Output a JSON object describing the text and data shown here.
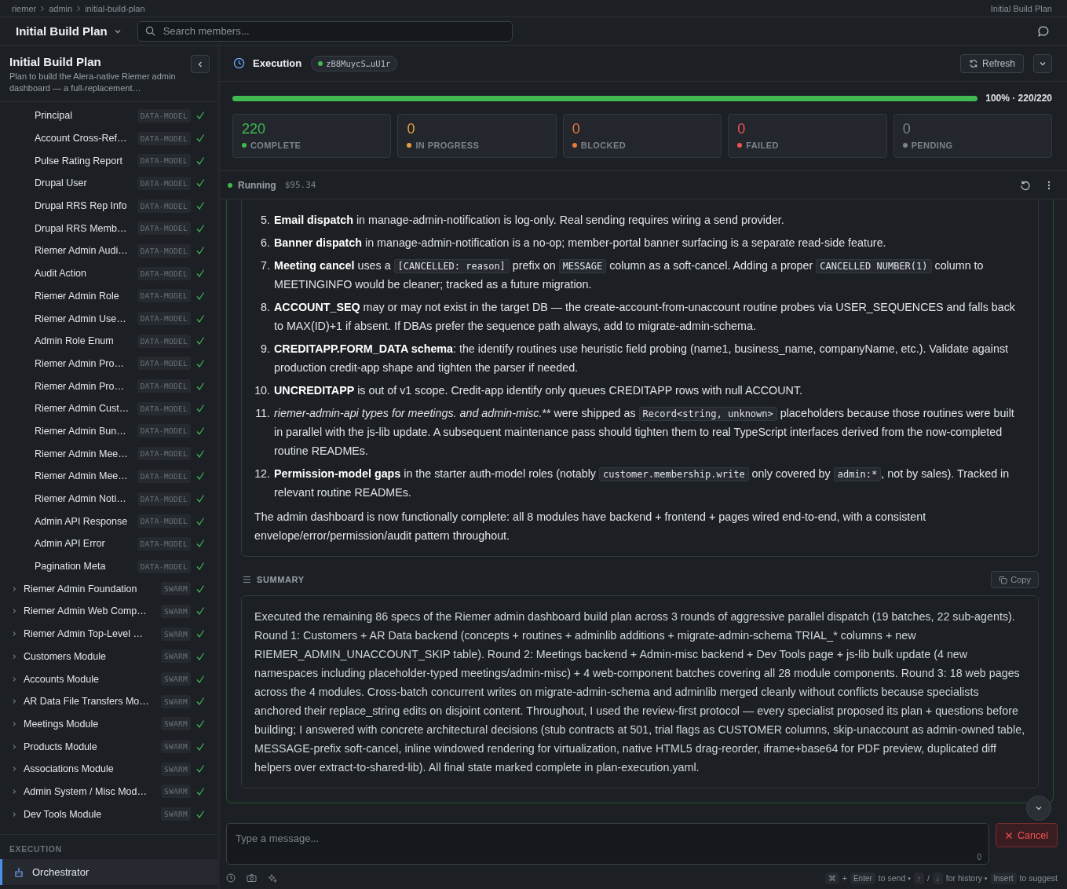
{
  "breadcrumb": {
    "items": [
      "riemer",
      "admin",
      "initial-build-plan"
    ],
    "right": "Initial Build Plan"
  },
  "header": {
    "title": "Initial Build Plan",
    "search_placeholder": "Search members..."
  },
  "sidebar": {
    "title": "Initial Build Plan",
    "description": "Plan to build the Alera-native Riemer admin dashboard — a full-replacement…",
    "items": [
      {
        "kind": "leaf",
        "label": "Principal",
        "tag": "DATA-MODEL",
        "done": true
      },
      {
        "kind": "leaf",
        "label": "Account Cross-Ref…",
        "tag": "DATA-MODEL",
        "done": true
      },
      {
        "kind": "leaf",
        "label": "Pulse Rating Report",
        "tag": "DATA-MODEL",
        "done": true
      },
      {
        "kind": "leaf",
        "label": "Drupal User",
        "tag": "DATA-MODEL",
        "done": true
      },
      {
        "kind": "leaf",
        "label": "Drupal RRS Rep Info",
        "tag": "DATA-MODEL",
        "done": true
      },
      {
        "kind": "leaf",
        "label": "Drupal RRS Memb…",
        "tag": "DATA-MODEL",
        "done": true
      },
      {
        "kind": "leaf",
        "label": "Riemer Admin Audi…",
        "tag": "DATA-MODEL",
        "done": true
      },
      {
        "kind": "leaf",
        "label": "Audit Action",
        "tag": "DATA-MODEL",
        "done": true
      },
      {
        "kind": "leaf",
        "label": "Riemer Admin Role",
        "tag": "DATA-MODEL",
        "done": true
      },
      {
        "kind": "leaf",
        "label": "Riemer Admin Use…",
        "tag": "DATA-MODEL",
        "done": true
      },
      {
        "kind": "leaf",
        "label": "Admin Role Enum",
        "tag": "DATA-MODEL",
        "done": true
      },
      {
        "kind": "leaf",
        "label": "Riemer Admin Pro…",
        "tag": "DATA-MODEL",
        "done": true
      },
      {
        "kind": "leaf",
        "label": "Riemer Admin Pro…",
        "tag": "DATA-MODEL",
        "done": true
      },
      {
        "kind": "leaf",
        "label": "Riemer Admin Cust…",
        "tag": "DATA-MODEL",
        "done": true
      },
      {
        "kind": "leaf",
        "label": "Riemer Admin Bun…",
        "tag": "DATA-MODEL",
        "done": true
      },
      {
        "kind": "leaf",
        "label": "Riemer Admin Mee…",
        "tag": "DATA-MODEL",
        "done": true
      },
      {
        "kind": "leaf",
        "label": "Riemer Admin Mee…",
        "tag": "DATA-MODEL",
        "done": true
      },
      {
        "kind": "leaf",
        "label": "Riemer Admin Noti…",
        "tag": "DATA-MODEL",
        "done": true
      },
      {
        "kind": "leaf",
        "label": "Admin API Response",
        "tag": "DATA-MODEL",
        "done": true
      },
      {
        "kind": "leaf",
        "label": "Admin API Error",
        "tag": "DATA-MODEL",
        "done": true
      },
      {
        "kind": "leaf",
        "label": "Pagination Meta",
        "tag": "DATA-MODEL",
        "done": true
      },
      {
        "kind": "group",
        "label": "Riemer Admin Foundation",
        "tag": "SWARM",
        "done": true
      },
      {
        "kind": "group",
        "label": "Riemer Admin Web Comp…",
        "tag": "SWARM",
        "done": true
      },
      {
        "kind": "group",
        "label": "Riemer Admin Top-Level …",
        "tag": "SWARM",
        "done": true
      },
      {
        "kind": "group",
        "label": "Customers Module",
        "tag": "SWARM",
        "done": true
      },
      {
        "kind": "group",
        "label": "Accounts Module",
        "tag": "SWARM",
        "done": true
      },
      {
        "kind": "group",
        "label": "AR Data File Transfers Mo…",
        "tag": "SWARM",
        "done": true
      },
      {
        "kind": "group",
        "label": "Meetings Module",
        "tag": "SWARM",
        "done": true
      },
      {
        "kind": "group",
        "label": "Products Module",
        "tag": "SWARM",
        "done": true
      },
      {
        "kind": "group",
        "label": "Associations Module",
        "tag": "SWARM",
        "done": true
      },
      {
        "kind": "group",
        "label": "Admin System / Misc Mod…",
        "tag": "SWARM",
        "done": true
      },
      {
        "kind": "group",
        "label": "Dev Tools Module",
        "tag": "SWARM",
        "done": true
      }
    ],
    "section_title": "EXECUTION",
    "section_items": [
      {
        "label": "Orchestrator",
        "selected": true
      }
    ]
  },
  "execution": {
    "title": "Execution",
    "run_id": "zB8MuycS…uU1r",
    "refresh": "Refresh",
    "progress": {
      "level": 1.0,
      "reading": "100% · 220/220"
    },
    "stats": [
      {
        "value": "220",
        "label": "COMPLETE",
        "color": "#3fb950"
      },
      {
        "value": "0",
        "label": "IN PROGRESS",
        "color": "#e3a33a"
      },
      {
        "value": "0",
        "label": "BLOCKED",
        "color": "#e8793a"
      },
      {
        "value": "0",
        "label": "FAILED",
        "color": "#f05252"
      },
      {
        "value": "0",
        "label": "PENDING",
        "color": "#7d838c"
      }
    ]
  },
  "run": {
    "status": "Running",
    "cost": "$95.34"
  },
  "message": {
    "items": [
      {
        "number": "5.",
        "segments": [
          {
            "kind": "bold",
            "text": "Email dispatch"
          },
          {
            "kind": "text",
            "text": " in manage-admin-notification is log-only. Real sending requires wiring a send provider."
          }
        ]
      },
      {
        "number": "6.",
        "segments": [
          {
            "kind": "bold",
            "text": "Banner dispatch"
          },
          {
            "kind": "text",
            "text": " in manage-admin-notification is a no-op; member-portal banner surfacing is a separate read-side feature."
          }
        ]
      },
      {
        "number": "7.",
        "segments": [
          {
            "kind": "bold",
            "text": "Meeting cancel"
          },
          {
            "kind": "text",
            "text": " uses a "
          },
          {
            "kind": "code",
            "text": "[CANCELLED: reason]"
          },
          {
            "kind": "text",
            "text": " prefix on "
          },
          {
            "kind": "code",
            "text": "MESSAGE"
          },
          {
            "kind": "text",
            "text": " column as a soft-cancel. Adding a proper "
          },
          {
            "kind": "code",
            "text": "CANCELLED NUMBER(1)"
          },
          {
            "kind": "text",
            "text": " column to MEETINGINFO would be cleaner; tracked as a future migration."
          }
        ]
      },
      {
        "number": "8.",
        "segments": [
          {
            "kind": "bold",
            "text": "ACCOUNT_SEQ"
          },
          {
            "kind": "text",
            "text": " may or may not exist in the target DB — the create-account-from-unaccount routine probes via USER_SEQUENCES and falls back to MAX(ID)+1 if absent. If DBAs prefer the sequence path always, add to migrate-admin-schema."
          }
        ]
      },
      {
        "number": "9.",
        "segments": [
          {
            "kind": "bold",
            "text": "CREDITAPP.FORM_DATA schema"
          },
          {
            "kind": "text",
            "text": ": the identify routines use heuristic field probing (name1, business_name, companyName, etc.). Validate against production credit-app shape and tighten the parser if needed."
          }
        ]
      },
      {
        "number": "10.",
        "segments": [
          {
            "kind": "bold",
            "text": "UNCREDITAPP"
          },
          {
            "kind": "text",
            "text": " is out of v1 scope. Credit-app identify only queues CREDITAPP rows with null ACCOUNT."
          }
        ]
      },
      {
        "number": "11.",
        "segments": [
          {
            "kind": "italic",
            "text": "riemer-admin-api types for meetings. and admin-misc."
          },
          {
            "kind": "text",
            "text": "** were shipped as "
          },
          {
            "kind": "code",
            "text": "Record<string, unknown>"
          },
          {
            "kind": "text",
            "text": " placeholders because those routines were built in parallel with the js-lib update. A subsequent maintenance pass should tighten them to real TypeScript interfaces derived from the now-completed routine READMEs."
          }
        ]
      },
      {
        "number": "12.",
        "segments": [
          {
            "kind": "bold",
            "text": "Permission-model gaps"
          },
          {
            "kind": "text",
            "text": " in the starter auth-model roles (notably "
          },
          {
            "kind": "code",
            "text": "customer.membership.write"
          },
          {
            "kind": "text",
            "text": " only covered by "
          },
          {
            "kind": "code",
            "text": "admin:*"
          },
          {
            "kind": "text",
            "text": ", not by sales). Tracked in relevant routine READMEs."
          }
        ]
      }
    ],
    "closing": "The admin dashboard is now functionally complete: all 8 modules have backend + frontend + pages wired end-to-end, with a consistent envelope/error/permission/audit pattern throughout."
  },
  "summary": {
    "title": "SUMMARY",
    "copy": "Copy",
    "text": "Executed the remaining 86 specs of the Riemer admin dashboard build plan across 3 rounds of aggressive parallel dispatch (19 batches, 22 sub-agents). Round 1: Customers + AR Data backend (concepts + routines + adminlib additions + migrate-admin-schema TRIAL_* columns + new RIEMER_ADMIN_UNACCOUNT_SKIP table). Round 2: Meetings backend + Admin-misc backend + Dev Tools page + js-lib bulk update (4 new namespaces including placeholder-typed meetings/admin-misc) + 4 web-component batches covering all 28 module components. Round 3: 18 web pages across the 4 modules. Cross-batch concurrent writes on migrate-admin-schema and adminlib merged cleanly without conflicts because specialists anchored their replace_string edits on disjoint content. Throughout, I used the review-first protocol — every specialist proposed its plan + questions before building; I answered with concrete architectural decisions (stub contracts at 501, trial flags as CUSTOMER columns, skip-unaccount as admin-owned table, MESSAGE-prefix soft-cancel, inline windowed rendering for virtualization, native HTML5 drag-reorder, iframe+base64 for PDF preview, duplicated diff helpers over extract-to-shared-lib). All final state marked complete in plan-execution.yaml."
  },
  "composer": {
    "placeholder": "Type a message...",
    "count": "0",
    "cancel": "Cancel",
    "hints": [
      {
        "kind": "key",
        "text": "⌘"
      },
      {
        "kind": "text",
        "text": "+"
      },
      {
        "kind": "key",
        "text": "Enter"
      },
      {
        "kind": "text",
        "text": "to send •"
      },
      {
        "kind": "key",
        "text": "↑"
      },
      {
        "kind": "text",
        "text": "/"
      },
      {
        "kind": "key",
        "text": "↓"
      },
      {
        "kind": "text",
        "text": "for history •"
      },
      {
        "kind": "key",
        "text": "Insert"
      },
      {
        "kind": "text",
        "text": "to suggest"
      }
    ]
  }
}
